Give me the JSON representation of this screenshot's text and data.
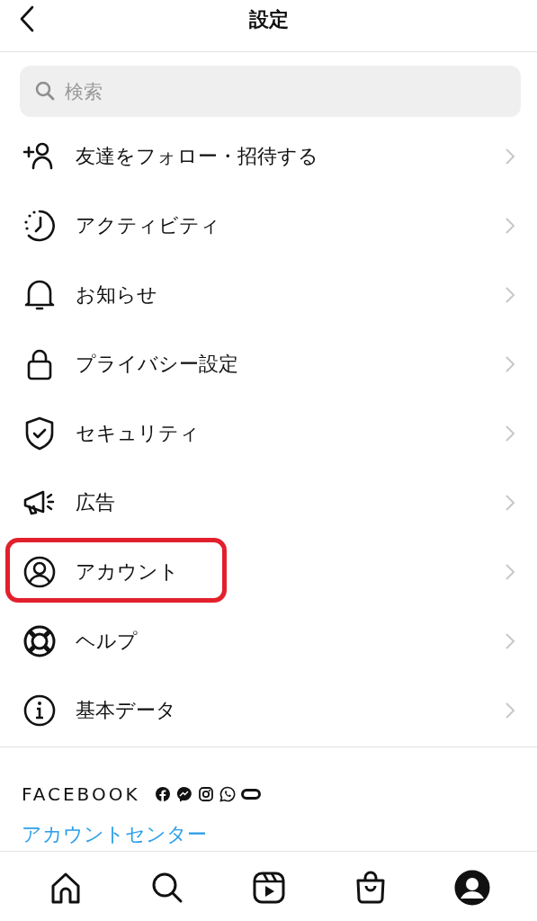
{
  "header": {
    "title": "設定"
  },
  "search": {
    "placeholder": "検索"
  },
  "menu": [
    {
      "label": "友達をフォロー・招待する",
      "highlighted": false
    },
    {
      "label": "アクティビティ",
      "highlighted": false
    },
    {
      "label": "お知らせ",
      "highlighted": false
    },
    {
      "label": "プライバシー設定",
      "highlighted": false
    },
    {
      "label": "セキュリティ",
      "highlighted": false
    },
    {
      "label": "広告",
      "highlighted": false
    },
    {
      "label": "アカウント",
      "highlighted": true
    },
    {
      "label": "ヘルプ",
      "highlighted": false
    },
    {
      "label": "基本データ",
      "highlighted": false
    }
  ],
  "facebook": {
    "heading": "FACEBOOK",
    "link": "アカウントセンター"
  },
  "tab_bar": [
    {
      "selected": false
    },
    {
      "selected": false
    },
    {
      "selected": false
    },
    {
      "selected": false
    },
    {
      "selected": true
    }
  ]
}
